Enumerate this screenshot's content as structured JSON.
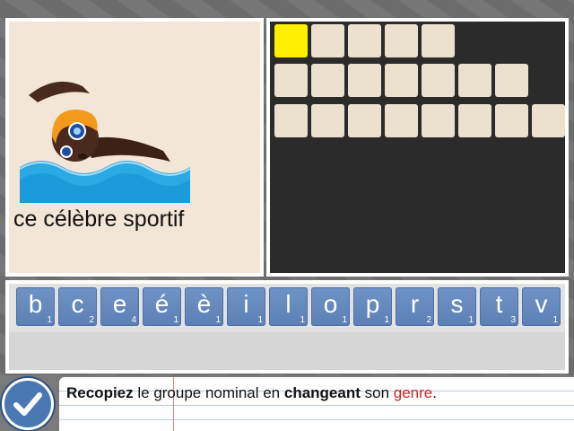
{
  "picture": {
    "image": "swimmer-emoji",
    "caption": "ce célèbre sportif"
  },
  "answer_grid": {
    "rows": [
      5,
      7,
      8
    ],
    "active_cell": {
      "row": 0,
      "col": 0
    },
    "colors": {
      "cell": "#ece0cf",
      "active": "#ffef00",
      "background": "#2b2b2b"
    }
  },
  "tiles": [
    {
      "letter": "b",
      "count": "1"
    },
    {
      "letter": "c",
      "count": "2"
    },
    {
      "letter": "e",
      "count": "4"
    },
    {
      "letter": "é",
      "count": "1"
    },
    {
      "letter": "è",
      "count": "1"
    },
    {
      "letter": "i",
      "count": "1"
    },
    {
      "letter": "l",
      "count": "1"
    },
    {
      "letter": "o",
      "count": "1"
    },
    {
      "letter": "p",
      "count": "1"
    },
    {
      "letter": "r",
      "count": "2"
    },
    {
      "letter": "s",
      "count": "1"
    },
    {
      "letter": "t",
      "count": "3"
    },
    {
      "letter": "v",
      "count": "1"
    }
  ],
  "instruction": {
    "part1": "Recopiez",
    "part2": " le groupe nominal en ",
    "part3": "changeant",
    "part4": " son ",
    "part5": "genre",
    "part6": "."
  },
  "check_button": {
    "icon": "checkmark-icon"
  }
}
